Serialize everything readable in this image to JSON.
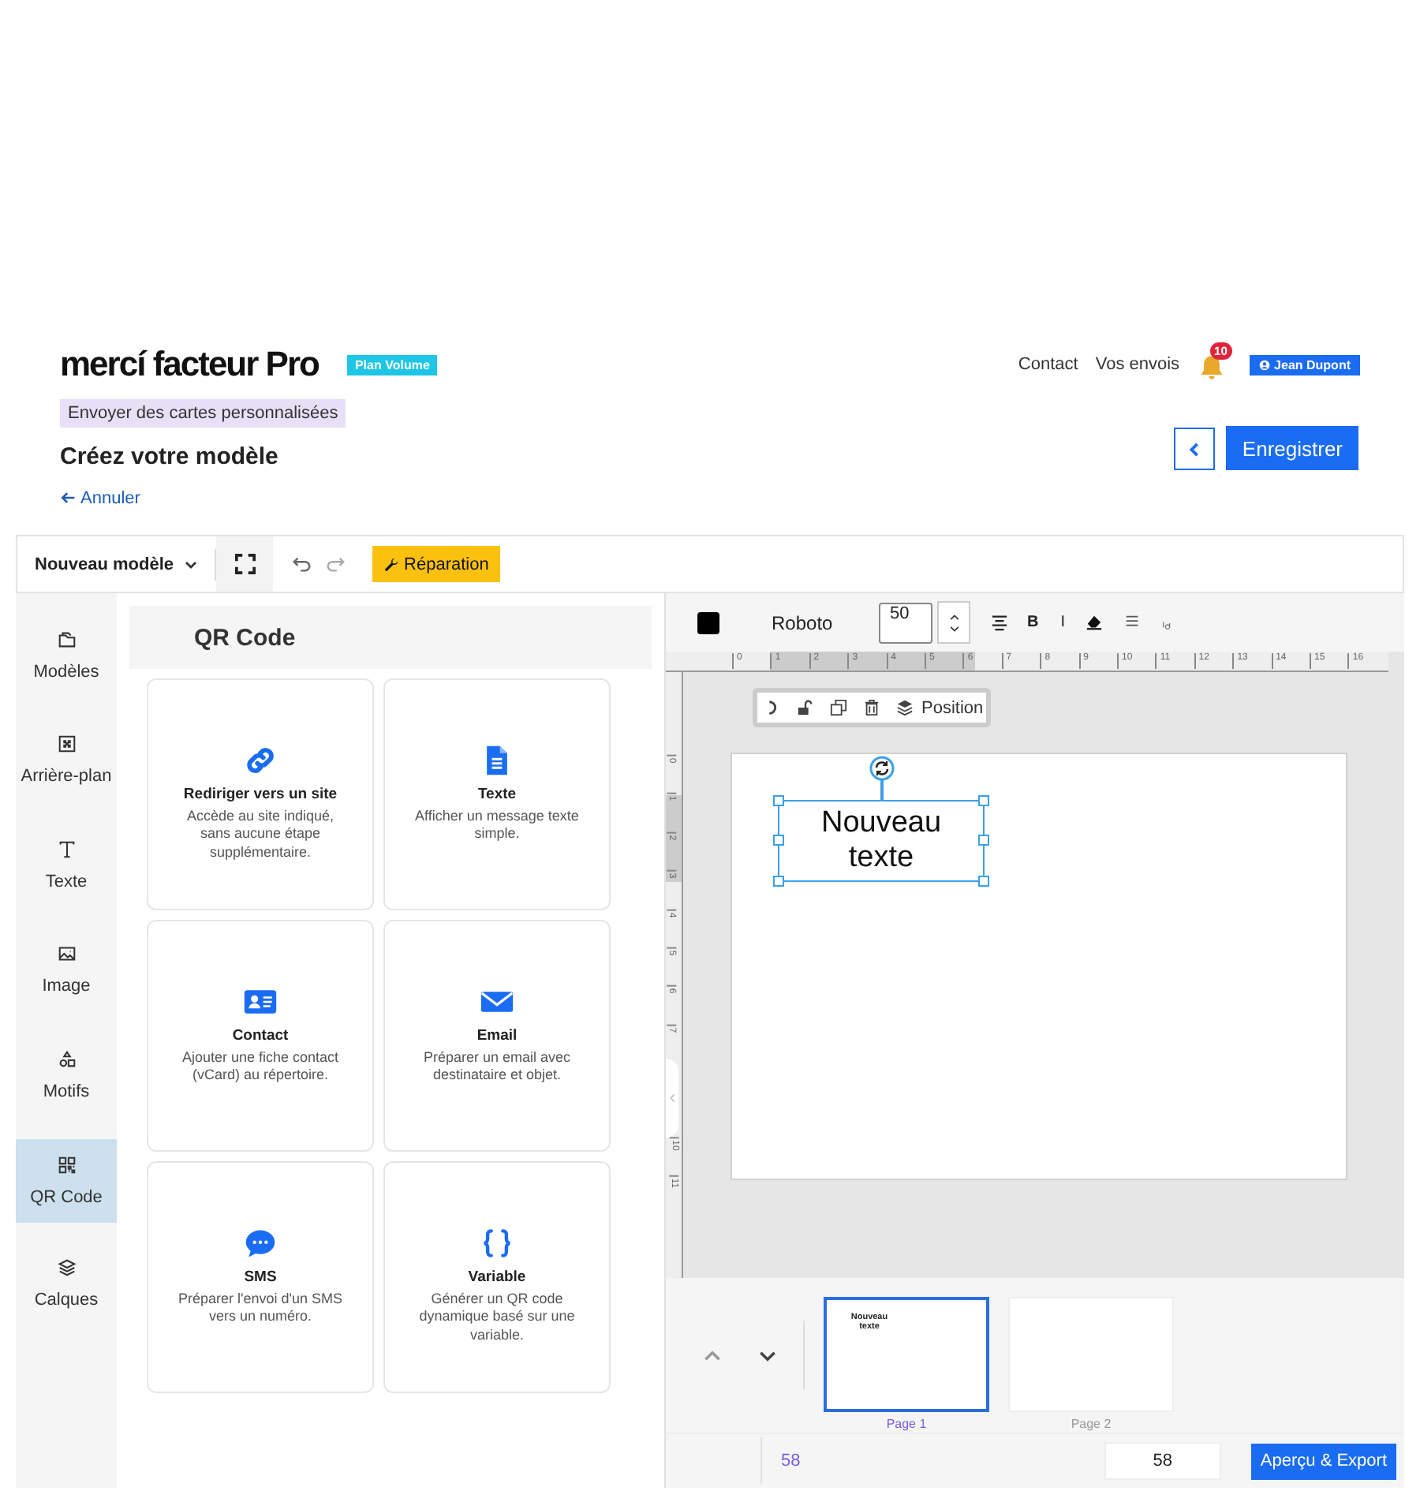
{
  "header": {
    "logo": "mercí facteur Pro",
    "plan_badge": "Plan Volume",
    "nav": [
      "Contact",
      "Vos envois"
    ],
    "notifications": "10",
    "user": "Jean Dupont"
  },
  "subtitle_tag": "Envoyer des cartes personnalisées",
  "page_title": "Créez votre modèle",
  "save_button": "Enregistrer",
  "cancel_link": "Annuler",
  "toolbar": {
    "template_select": "Nouveau modèle",
    "repair_button": "Réparation"
  },
  "sidebar": {
    "items": [
      {
        "label": "Modèles",
        "selected": false
      },
      {
        "label": "Arrière-plan",
        "selected": false
      },
      {
        "label": "Texte",
        "selected": false
      },
      {
        "label": "Image",
        "selected": false
      },
      {
        "label": "Motifs",
        "selected": false
      },
      {
        "label": "QR Code",
        "selected": true
      },
      {
        "label": "Calques",
        "selected": false
      }
    ]
  },
  "panel": {
    "title": "QR Code",
    "cards": [
      {
        "title": "Rediriger vers un site",
        "description": "Accède au site indiqué, sans aucune étape supplémentaire."
      },
      {
        "title": "Texte",
        "description": "Afficher un message texte simple."
      },
      {
        "title": "Contact",
        "description": "Ajouter une fiche contact (vCard) au répertoire."
      },
      {
        "title": "Email",
        "description": "Préparer un email avec destinataire et objet."
      },
      {
        "title": "SMS",
        "description": "Préparer l'envoi d'un SMS vers un numéro."
      },
      {
        "title": "Variable",
        "description": "Générer un QR code dynamique basé sur une variable."
      }
    ]
  },
  "format_bar": {
    "font": "Roboto",
    "size": "50",
    "bold": "B",
    "italic": "I"
  },
  "rulers": {
    "horizontal": [
      "0",
      "1",
      "2",
      "3",
      "4",
      "5",
      "6",
      "7",
      "8",
      "9",
      "10",
      "11",
      "12",
      "13",
      "14",
      "15",
      "16"
    ],
    "vertical": [
      "0",
      "1",
      "2",
      "3",
      "4",
      "5",
      "6",
      "7",
      "10",
      "11"
    ]
  },
  "element_toolbar": {
    "position_button": "Position"
  },
  "canvas": {
    "text_element": "Nouveau texte"
  },
  "pages": [
    {
      "label": "Page 1",
      "preview_text": "Nouveau texte",
      "selected": true
    },
    {
      "label": "Page 2",
      "selected": false
    }
  ],
  "footer": {
    "count": "58",
    "zoom_value": "58",
    "export_button": "Aperçu & Export"
  }
}
